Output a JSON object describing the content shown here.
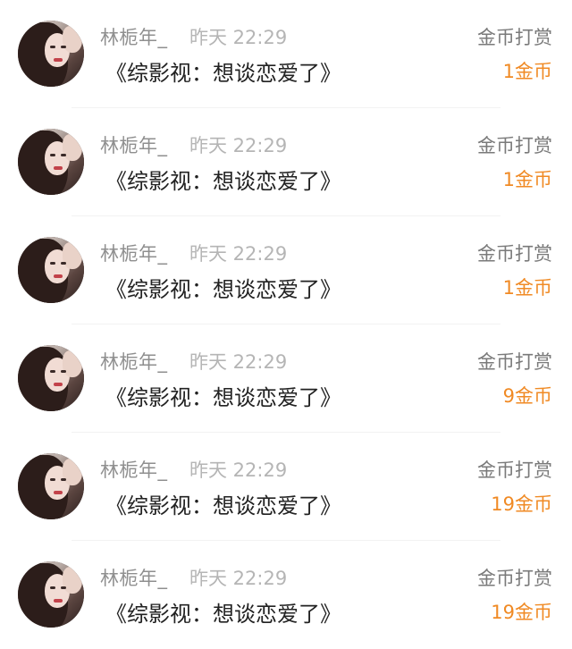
{
  "items": [
    {
      "username": "林栀年_",
      "time": "昨天 22:29",
      "type_label": "金币打赏",
      "book_title": "《综影视：想谈恋爱了》",
      "amount": "1金币"
    },
    {
      "username": "林栀年_",
      "time": "昨天 22:29",
      "type_label": "金币打赏",
      "book_title": "《综影视：想谈恋爱了》",
      "amount": "1金币"
    },
    {
      "username": "林栀年_",
      "time": "昨天 22:29",
      "type_label": "金币打赏",
      "book_title": "《综影视：想谈恋爱了》",
      "amount": "1金币"
    },
    {
      "username": "林栀年_",
      "time": "昨天 22:29",
      "type_label": "金币打赏",
      "book_title": "《综影视：想谈恋爱了》",
      "amount": "9金币"
    },
    {
      "username": "林栀年_",
      "time": "昨天 22:29",
      "type_label": "金币打赏",
      "book_title": "《综影视：想谈恋爱了》",
      "amount": "19金币"
    },
    {
      "username": "林栀年_",
      "time": "昨天 22:29",
      "type_label": "金币打赏",
      "book_title": "《综影视：想谈恋爱了》",
      "amount": "19金币"
    }
  ],
  "colors": {
    "amount": "#f08a24",
    "username": "#8f8f8f",
    "time": "#b5b5b5",
    "title": "#222222"
  }
}
